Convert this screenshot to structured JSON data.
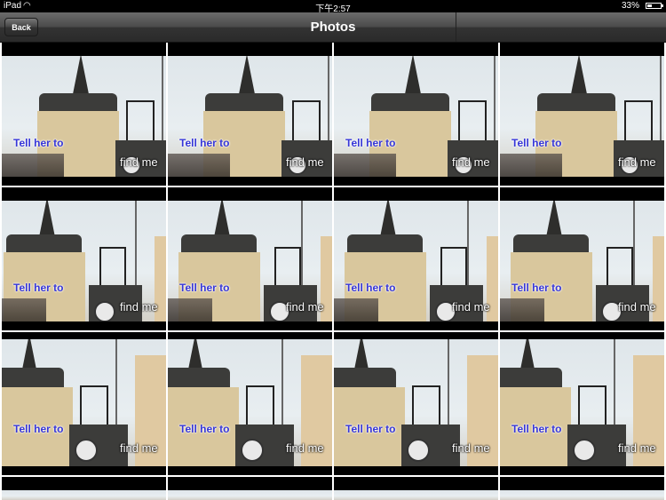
{
  "status_bar": {
    "carrier": "iPad",
    "time": "下午2:57",
    "battery_percent_label": "33%",
    "battery_level": 0.33
  },
  "nav_bar": {
    "back_label": "Back",
    "title": "Photos"
  },
  "photos": [
    {
      "line1": "Tell her to",
      "line2": "find me"
    },
    {
      "line1": "Tell her to",
      "line2": "find me"
    },
    {
      "line1": "Tell her to",
      "line2": "find me"
    },
    {
      "line1": "Tell her to",
      "line2": "find me"
    },
    {
      "line1": "Tell her to",
      "line2": "find me"
    },
    {
      "line1": "Tell her to",
      "line2": "find me"
    },
    {
      "line1": "Tell her to",
      "line2": "find me"
    },
    {
      "line1": "Tell her to",
      "line2": "find me"
    },
    {
      "line1": "Tell her to",
      "line2": "find me"
    },
    {
      "line1": "Tell her to",
      "line2": "find me"
    },
    {
      "line1": "Tell her to",
      "line2": "find me"
    },
    {
      "line1": "Tell her to",
      "line2": "find me"
    }
  ]
}
